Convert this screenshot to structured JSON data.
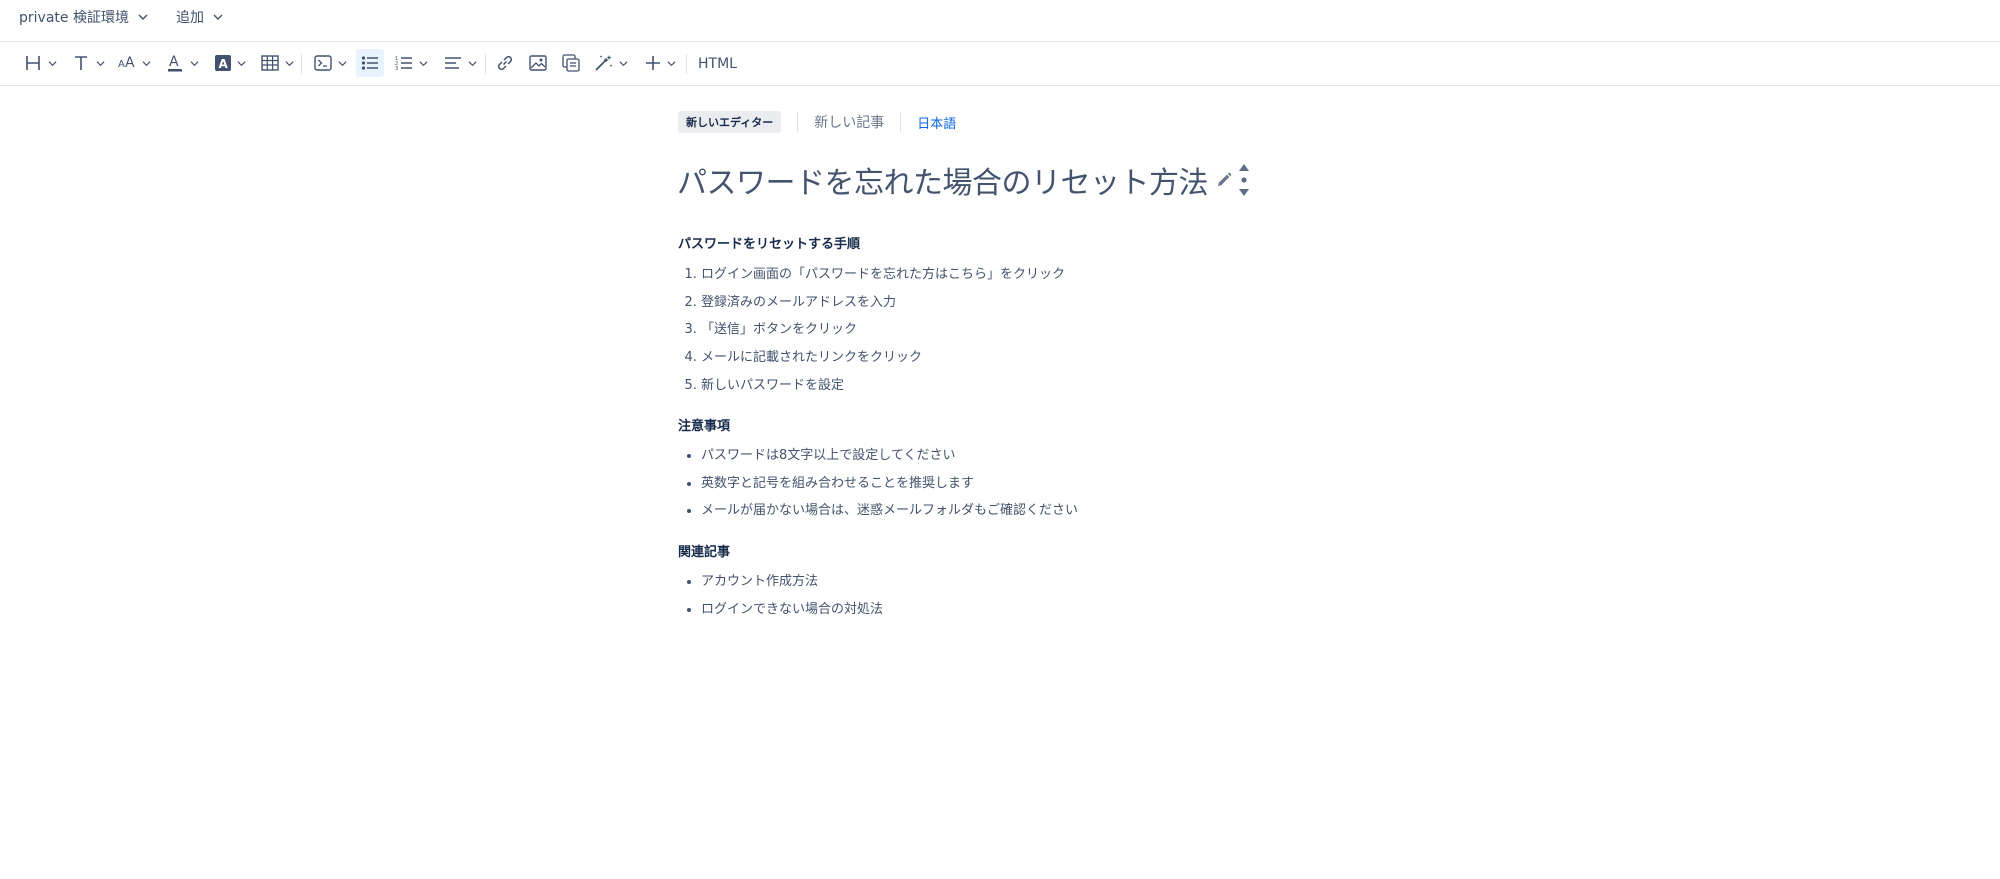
{
  "topbar": {
    "workspace_label": "private 検証環境",
    "add_label": "追加"
  },
  "toolbar": {
    "buttons": [
      "heading-icon",
      "text-style-icon",
      "font-size-icon",
      "font-color-icon",
      "highlight-icon",
      "table-icon",
      "code-block-icon",
      "bullet-list-icon",
      "numbered-list-icon",
      "align-icon",
      "link-icon",
      "image-icon",
      "embed-icon",
      "ai-magic-icon",
      "insert-icon"
    ],
    "html_label": "HTML",
    "active_button": "bullet-list-icon",
    "accent_color": "#e9f2ff"
  },
  "meta": {
    "badge": "新しいエディター",
    "status": "新しい記事",
    "language": "日本語"
  },
  "article": {
    "title": "パスワードを忘れた場合のリセット方法",
    "sections": [
      {
        "heading": "パスワードをリセットする手順",
        "type": "ordered",
        "items": [
          "ログイン画面の「パスワードを忘れた方はこちら」をクリック",
          "登録済みのメールアドレスを入力",
          "「送信」ボタンをクリック",
          "メールに記載されたリンクをクリック",
          "新しいパスワードを設定"
        ]
      },
      {
        "heading": "注意事項",
        "type": "bulleted",
        "items": [
          "パスワードは8文字以上で設定してください",
          "英数字と記号を組み合わせることを推奨します",
          "メールが届かない場合は、迷惑メールフォルダもご確認ください"
        ]
      },
      {
        "heading": "関連記事",
        "type": "bulleted",
        "items": [
          "アカウント作成方法",
          "ログインできない場合の対処法"
        ]
      }
    ]
  }
}
